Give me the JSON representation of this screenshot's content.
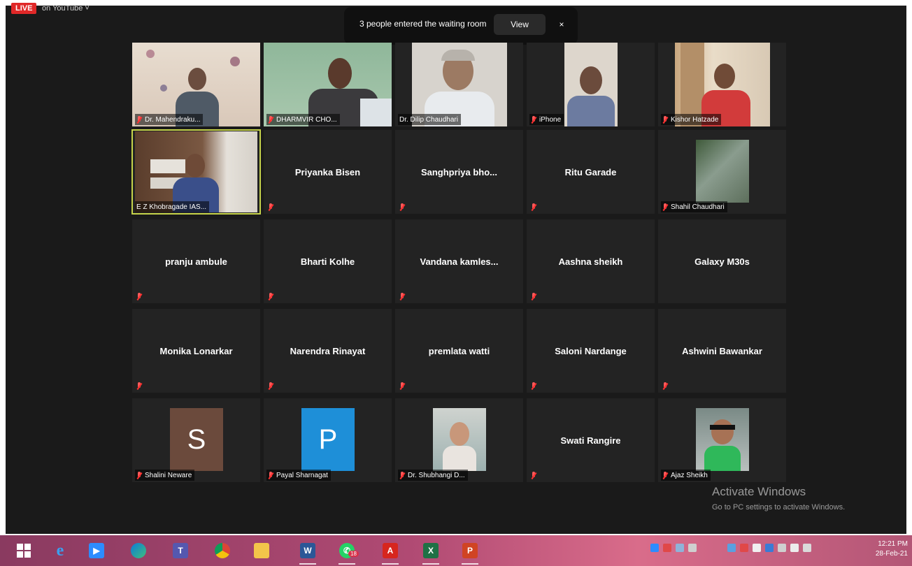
{
  "live": {
    "badge": "LIVE",
    "destination": "on YouTube ˅"
  },
  "waiting_room": {
    "message": "3 people entered the waiting room",
    "view_label": "View",
    "close_label": "×"
  },
  "grid": {
    "row1": [
      {
        "label": "Dr. Mahendraku..."
      },
      {
        "label": "DHARMVIR CHO..."
      },
      {
        "label": "Dr. Dilip Chaudhari"
      },
      {
        "label": "iPhone"
      },
      {
        "label": "Kishor Hatzade"
      }
    ],
    "row2": [
      {
        "label": "E Z Khobragade IAS..."
      },
      {
        "name": "Priyanka Bisen"
      },
      {
        "name": "Sanghpriya  bho..."
      },
      {
        "name": "Ritu Garade"
      },
      {
        "label": "Shahil Chaudhari"
      }
    ],
    "row3": [
      {
        "name": "pranju ambule"
      },
      {
        "name": "Bharti Kolhe"
      },
      {
        "name": "Vandana  kamles..."
      },
      {
        "name": "Aashna sheikh"
      },
      {
        "name": "Galaxy M30s"
      }
    ],
    "row4": [
      {
        "name": "Monika Lonarkar"
      },
      {
        "name": "Narendra Rinayat"
      },
      {
        "name": "premlata watti"
      },
      {
        "name": "Saloni Nardange"
      },
      {
        "name": "Ashwini Bawankar"
      }
    ],
    "row5": [
      {
        "initial": "S",
        "label": "Shalini Neware",
        "color": "#6b4a3c"
      },
      {
        "initial": "P",
        "label": "Payal Sharnagat",
        "color": "#1e8fd8"
      },
      {
        "label": "Dr. Shubhangi D..."
      },
      {
        "name": "Swati Rangire"
      },
      {
        "label": "Ajaz Sheikh"
      }
    ]
  },
  "watermark": {
    "title": "Activate Windows",
    "subtitle": "Go to PC settings to activate Windows."
  },
  "taskbar": {
    "icons": [
      "windows-start-icon",
      "internet-explorer-icon",
      "zoom-app-icon",
      "edge-icon",
      "teams-icon",
      "chrome-icon",
      "file-explorer-icon",
      "word-icon",
      "whatsapp-icon",
      "acrobat-icon",
      "excel-icon",
      "powerpoint-icon"
    ],
    "whatsapp_badge": "18",
    "clock_time": "12:21 PM",
    "clock_date": "28-Feb-21"
  },
  "colors": {
    "meeting_bg": "#1a1a1a",
    "tile_bg": "#232323",
    "active_speaker": "#c6d34a",
    "live_red": "#e02828"
  }
}
